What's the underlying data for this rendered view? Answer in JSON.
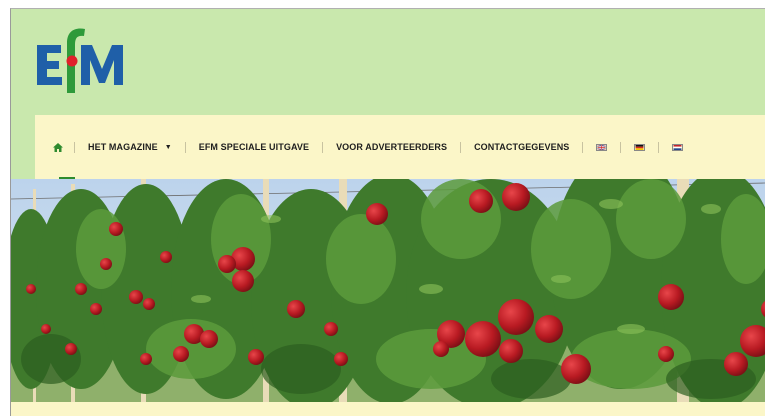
{
  "brand": {
    "logo_letters": "EfM",
    "colors": {
      "blue": "#1f5fa8",
      "green": "#2e9a3a",
      "red": "#e0202a",
      "header_bg": "#c9e8ad",
      "nav_bg": "#fbf6c8"
    }
  },
  "nav": {
    "home_icon": "home-icon",
    "items": [
      {
        "label": "HET MAGAZINE",
        "dropdown": true
      },
      {
        "label": "EFM SPECIALE UITGAVE"
      },
      {
        "label": "VOOR ADVERTEERDERS"
      },
      {
        "label": "CONTACTGEGEVENS"
      }
    ],
    "languages": [
      "english-flag-icon",
      "german-flag-icon",
      "dutch-flag-icon"
    ]
  },
  "hero": {
    "subject": "apple-orchard-image"
  }
}
